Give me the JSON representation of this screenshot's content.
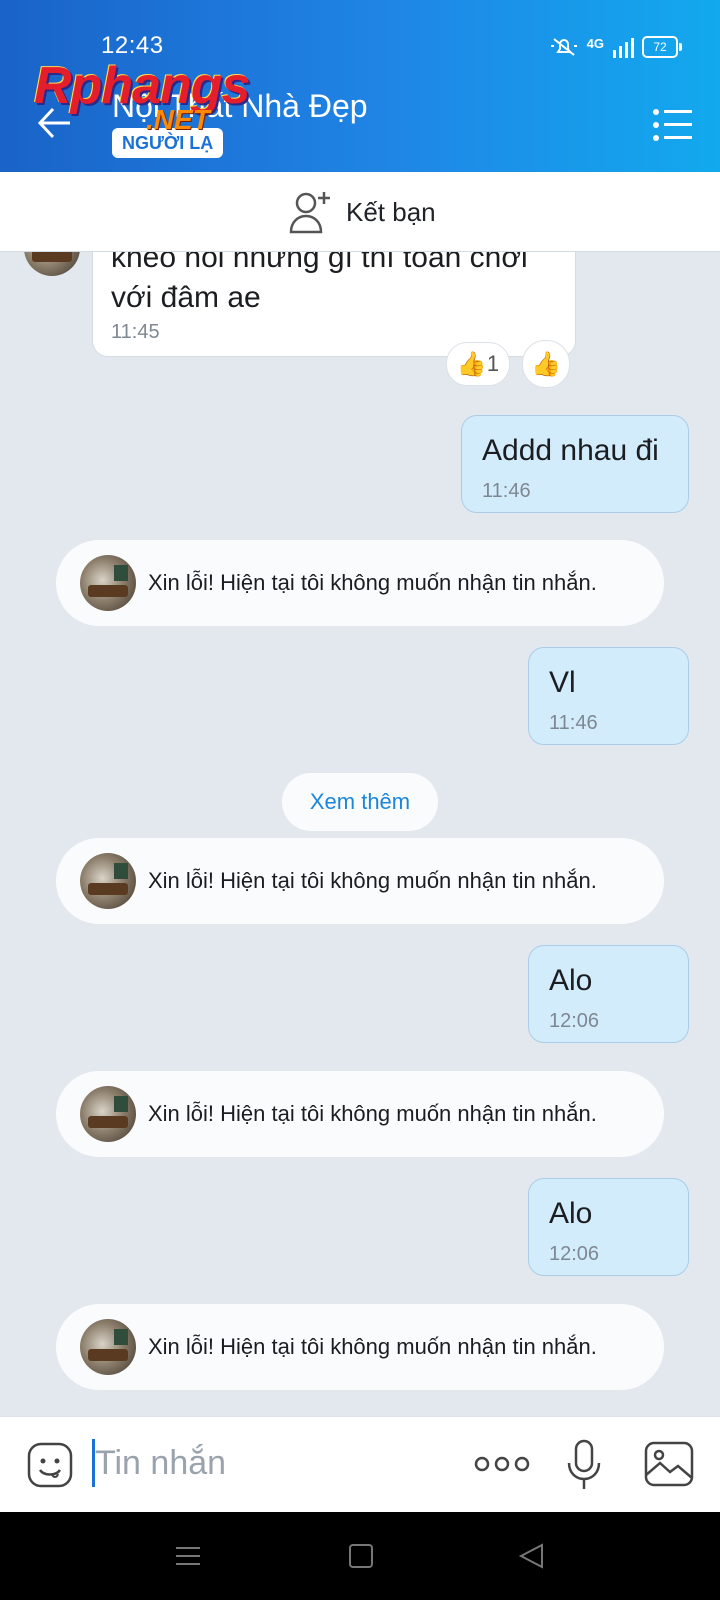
{
  "status_bar": {
    "time": "12:43",
    "network": "4G",
    "battery": "72"
  },
  "header": {
    "title": "Nội Thất Nhà Đẹp",
    "badge": "NGƯỜI LẠ",
    "watermark": "Rphangs",
    "watermark_suffix": ".NET"
  },
  "add_friend": {
    "label": "Kết bạn"
  },
  "messages": {
    "m1": {
      "line1": "khéo nói nhưng gì thì toàn chơi",
      "line2": "với đâm ae",
      "time": "11:45",
      "reaction_count": "1"
    },
    "m2": {
      "text": "Addd nhau đi",
      "time": "11:46"
    },
    "sys1": {
      "text": "Xin lỗi! Hiện tại tôi không muốn nhận tin nhắn."
    },
    "m3": {
      "text": "Vl",
      "time": "11:46"
    },
    "see_more": "Xem thêm",
    "sys2": {
      "text": "Xin lỗi! Hiện tại tôi không muốn nhận tin nhắn."
    },
    "m4": {
      "text": "Alo",
      "time": "12:06"
    },
    "sys3": {
      "text": "Xin lỗi! Hiện tại tôi không muốn nhận tin nhắn."
    },
    "m5": {
      "text": "Alo",
      "time": "12:06"
    },
    "sys4": {
      "text": "Xin lỗi! Hiện tại tôi không muốn nhận tin nhắn."
    }
  },
  "input": {
    "placeholder": "Tin nhắn",
    "value": ""
  },
  "colors": {
    "header_start": "#1a63c8",
    "header_end": "#12a9ee",
    "outgoing_bubble": "#d3ecfb",
    "link": "#1c86d8"
  },
  "icons": [
    "back-arrow-icon",
    "menu-list-icon",
    "add-friend-icon",
    "thumbs-up-icon",
    "emoji-icon",
    "more-dots-icon",
    "microphone-icon",
    "image-icon"
  ]
}
